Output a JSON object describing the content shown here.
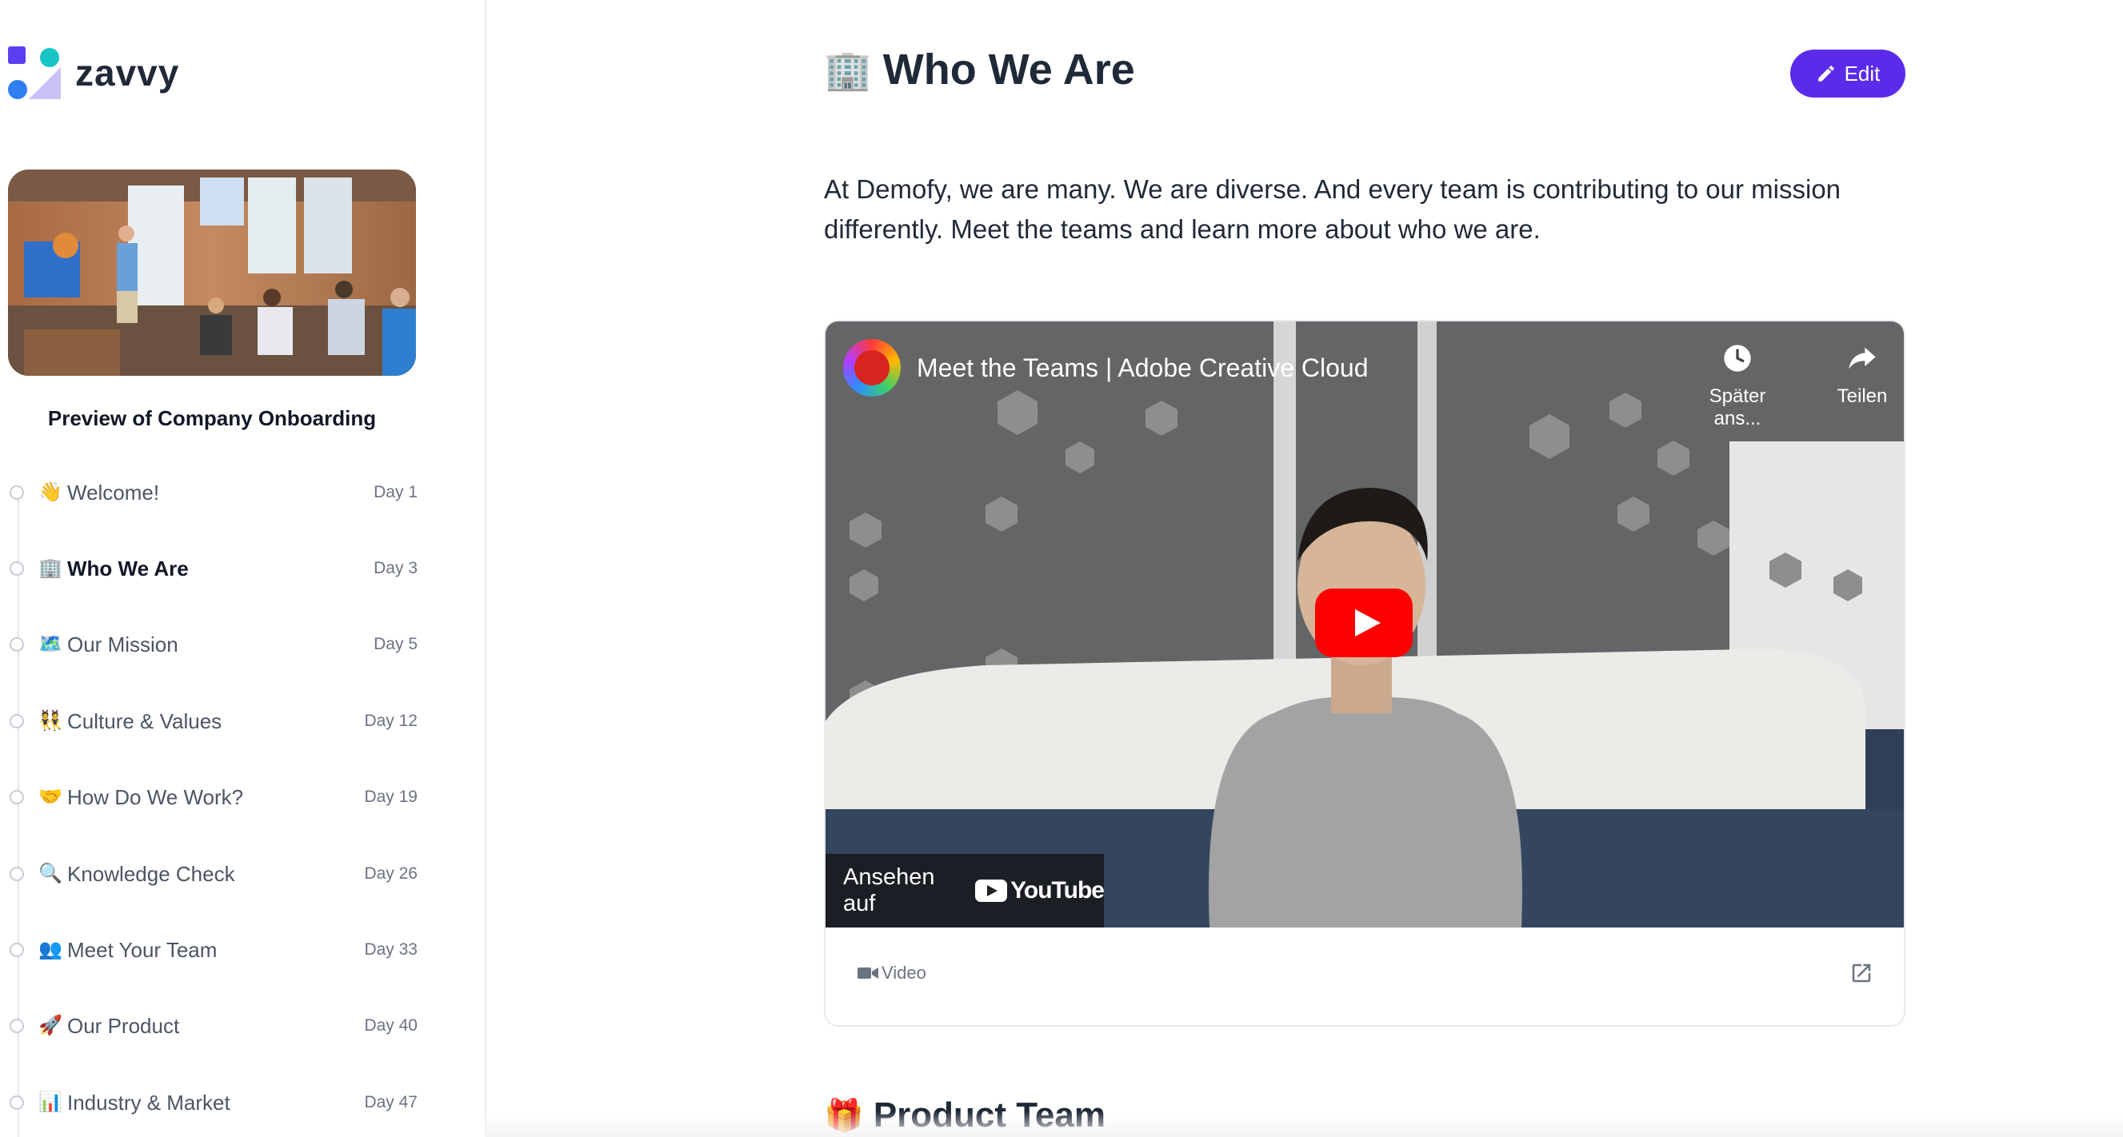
{
  "app": {
    "logo_text": "zavvy"
  },
  "sidebar": {
    "preview_title": "Preview of Company Onboarding",
    "steps": [
      {
        "emoji": "👋",
        "label": "Welcome!",
        "day": "Day 1"
      },
      {
        "emoji": "🏢",
        "label": "Who We Are",
        "day": "Day 3",
        "active": true
      },
      {
        "emoji": "🗺️",
        "label": "Our Mission",
        "day": "Day 5"
      },
      {
        "emoji": "👯",
        "label": "Culture & Values",
        "day": "Day 12"
      },
      {
        "emoji": "🤝",
        "label": "How Do We Work?",
        "day": "Day 19"
      },
      {
        "emoji": "🔍",
        "label": "Knowledge Check",
        "day": "Day 26"
      },
      {
        "emoji": "👥",
        "label": "Meet Your Team",
        "day": "Day 33"
      },
      {
        "emoji": "🚀",
        "label": "Our Product",
        "day": "Day 40"
      },
      {
        "emoji": "📊",
        "label": "Industry & Market",
        "day": "Day 47"
      }
    ]
  },
  "main": {
    "title_emoji": "🏢",
    "title": "Who We Are",
    "edit_label": "Edit",
    "intro": "At Demofy, we are many. We are diverse. And every team is contributing to our mission differently. Meet the teams and learn more about who we are.",
    "video": {
      "title": "Meet the Teams | Adobe Creative Cloud",
      "watch_later": "Später ans...",
      "share": "Teilen",
      "watch_on": "Ansehen auf",
      "youtube": "YouTube",
      "type_label": "Video"
    },
    "section_emoji": "🎁",
    "section_title": "Product Team"
  },
  "colors": {
    "accent": "#5b2bea",
    "youtube_red": "#ff0000",
    "logo_purple": "#5b3ff0",
    "logo_teal": "#19c4c4",
    "logo_blue": "#2f7ff0"
  }
}
